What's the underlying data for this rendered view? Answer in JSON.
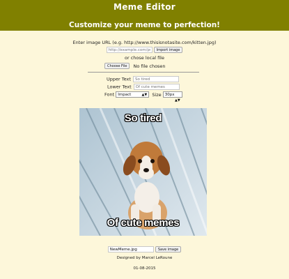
{
  "header": {
    "title": "Meme Editor",
    "subtitle": "Customize your meme to perfection!"
  },
  "image_url": {
    "label": "Enter image URL (e.g. http://www.thisisnotasite.com/kitten.jpg)",
    "placeholder": "http://example.com/puppy.jpg",
    "button": "Import image"
  },
  "local_file": {
    "label": "or chose local file",
    "button": "Choose File",
    "status": "No file chosen"
  },
  "form": {
    "upper_label": "Upper Text",
    "upper_placeholder": "So tired",
    "lower_label": "Lower Text",
    "lower_placeholder": "Of cute memes",
    "font_label": "Font",
    "font_value": "Impact",
    "size_label": "Size",
    "size_value": "30px"
  },
  "meme": {
    "upper_text": "So tired",
    "lower_text": "Of cute memes"
  },
  "save": {
    "filename": "NewMeme.jpg",
    "button": "Save image"
  },
  "footer": {
    "credit": "Designed by Marcel LeRoune",
    "date": "01-08-2015"
  }
}
